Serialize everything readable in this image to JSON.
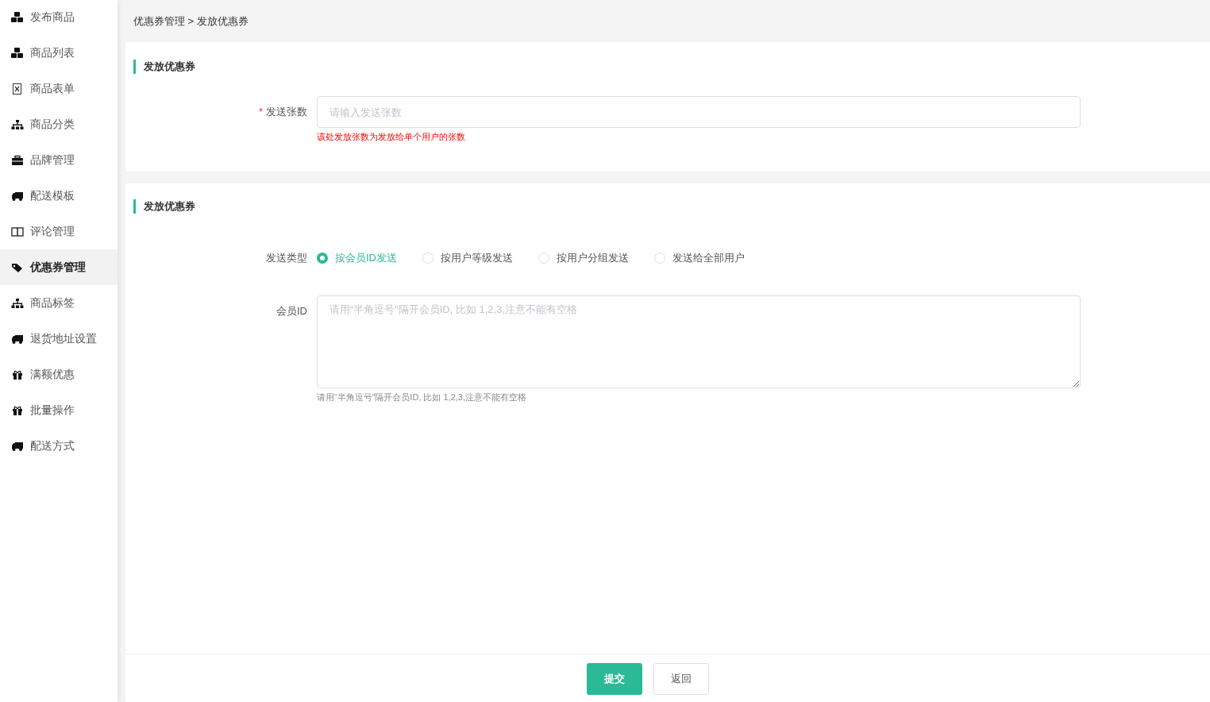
{
  "sidebar": {
    "items": [
      {
        "label": "发布商品",
        "kind": "cubes",
        "selected": false
      },
      {
        "label": "商品列表",
        "kind": "cubes",
        "selected": false
      },
      {
        "label": "商品表单",
        "kind": "file",
        "selected": false
      },
      {
        "label": "商品分类",
        "kind": "sitemap",
        "selected": false
      },
      {
        "label": "品牌管理",
        "kind": "briefcase",
        "selected": false
      },
      {
        "label": "配送模板",
        "kind": "truck",
        "selected": false
      },
      {
        "label": "评论管理",
        "kind": "columns",
        "selected": false
      },
      {
        "label": "优惠券管理",
        "kind": "tags",
        "selected": true
      },
      {
        "label": "商品标签",
        "kind": "sitemap",
        "selected": false
      },
      {
        "label": "退货地址设置",
        "kind": "truck",
        "selected": false
      },
      {
        "label": "满额优惠",
        "kind": "gift",
        "selected": false
      },
      {
        "label": "批量操作",
        "kind": "gift",
        "selected": false
      },
      {
        "label": "配送方式",
        "kind": "truck",
        "selected": false
      }
    ]
  },
  "breadcrumb": "优惠券管理 > 发放优惠券",
  "sections": [
    {
      "title": "发放优惠券",
      "fields": [
        {
          "kind": "input",
          "label": "发送张数",
          "required_mark": "*",
          "placeholder": "请输入发送张数",
          "hint": "该处发放张数为发放给单个用户的张数",
          "hint_error": true
        }
      ]
    },
    {
      "title": "发放优惠券",
      "fields": [
        {
          "kind": "radio",
          "label": "发送类型",
          "options": [
            {
              "label": "按会员ID发送",
              "selected": true
            },
            {
              "label": "按用户等级发送",
              "selected": false
            },
            {
              "label": "按用户分组发送",
              "selected": false
            },
            {
              "label": "发送给全部用户",
              "selected": false
            }
          ]
        },
        {
          "kind": "textarea",
          "label": "会员ID",
          "placeholder": "请用“半角逗号”隔开会员ID, 比如 1,2,3,注意不能有空格",
          "hint": "请用“半角逗号”隔开会员ID, 比如 1,2,3,注意不能有空格",
          "hint_error": false
        }
      ]
    }
  ],
  "buttons": [
    {
      "label": "提交",
      "kind": "primary"
    },
    {
      "label": "返回",
      "kind": "default"
    }
  ]
}
